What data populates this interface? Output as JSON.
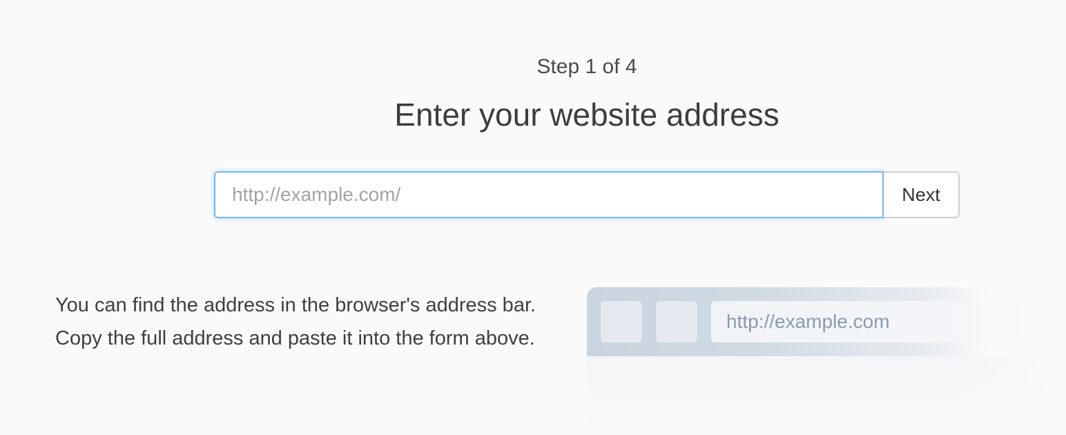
{
  "wizard": {
    "step_label": "Step 1 of 4",
    "title": "Enter your website address"
  },
  "form": {
    "url_placeholder": "http://example.com/",
    "url_value": "",
    "next_label": "Next"
  },
  "help": {
    "text": "You can find the address in the browser's address bar. Copy the full address and paste it into the form above."
  },
  "illustration": {
    "address_text": "http://example.com"
  },
  "colors": {
    "background": "#fafafa",
    "focus_border": "#7ab3ee",
    "text": "#3f3f3f",
    "placeholder": "#a3a3a3"
  }
}
